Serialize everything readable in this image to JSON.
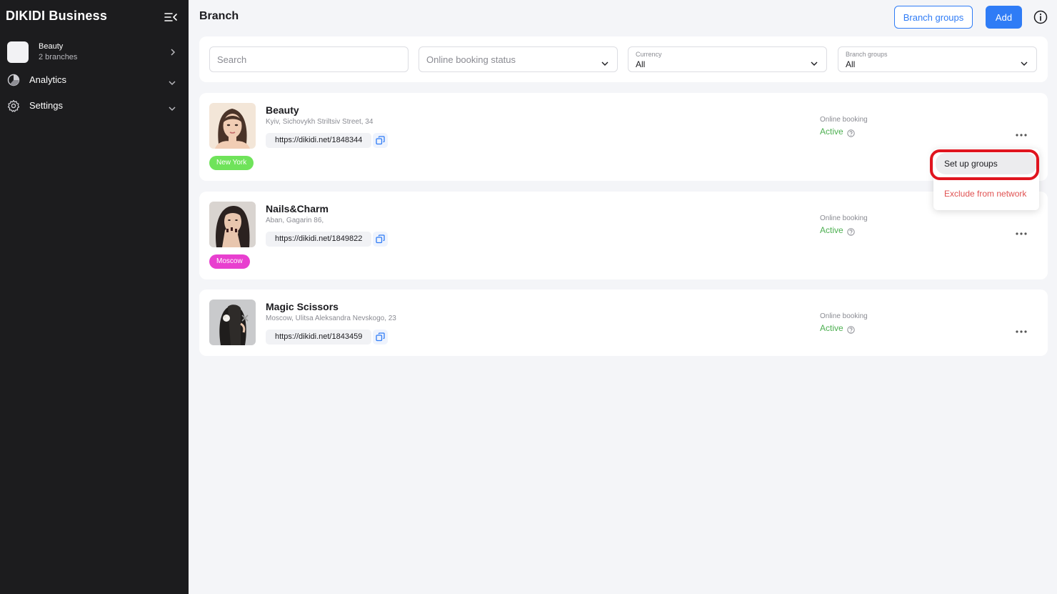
{
  "sidebar": {
    "brand": "DIKIDI Business",
    "account": {
      "name": "Beauty",
      "subtitle": "2 branches"
    },
    "items": [
      {
        "label": "Analytics"
      },
      {
        "label": "Settings"
      }
    ]
  },
  "header": {
    "title": "Branch",
    "branch_groups_label": "Branch groups",
    "add_label": "Add"
  },
  "filters": {
    "search_placeholder": "Search",
    "online_booking_status_placeholder": "Online booking status",
    "currency": {
      "label": "Currency",
      "value": "All"
    },
    "branch_groups": {
      "label": "Branch groups",
      "value": "All"
    }
  },
  "branches": [
    {
      "name": "Beauty",
      "address": "Kyiv, Sichovykh Striltsiv Street, 34",
      "link": "https://dikidi.net/1848344",
      "tag": "New York",
      "tag_color": "#6fe35a",
      "online_booking_label": "Online booking",
      "online_booking_status": "Active"
    },
    {
      "name": "Nails&Charm",
      "address": "Aban, Gagarin 86,",
      "link": "https://dikidi.net/1849822",
      "tag": "Moscow",
      "tag_color": "#e83fcf",
      "online_booking_label": "Online booking",
      "online_booking_status": "Active"
    },
    {
      "name": "Magic Scissors",
      "address": "Moscow, Ulitsa Aleksandra Nevskogo, 23",
      "link": "https://dikidi.net/1843459",
      "online_booking_label": "Online booking",
      "online_booking_status": "Active"
    }
  ],
  "menu": {
    "setup_groups": "Set up groups",
    "exclude": "Exclude from network"
  },
  "colors": {
    "accent": "#2f7cf6",
    "active_green": "#4caf50",
    "danger": "#e05252",
    "sidebar_bg": "#1c1c1e"
  }
}
